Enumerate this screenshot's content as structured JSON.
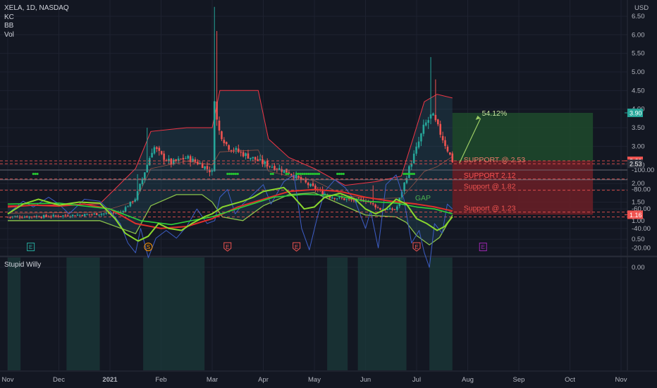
{
  "header": {
    "symbol_line": "XELA, 1D, NASDAQ",
    "indicators": [
      "KC",
      "BB",
      "Vol"
    ],
    "currency": "USD",
    "oscillator_name": "Stupid Willy"
  },
  "colors": {
    "background": "#131722",
    "grid": "#1e2230",
    "up": "#26a69a",
    "down": "#ef5350",
    "bb": "#f23645",
    "kc_lower": "#8bc34a",
    "osc_blue": "#3d5ec6",
    "osc_green": "#8ad82e",
    "osc_red": "#e0302b",
    "osc_bright_green": "#2ed13a",
    "target_box": "#1f4a2b",
    "stop_box": "#6b1f26",
    "support_line": "#ef5350",
    "gap_text": "#4caf50",
    "arrow": "#9ccc65"
  },
  "chart_data": [
    {
      "type": "candlestick",
      "title": "XELA, 1D, NASDAQ",
      "x_ticks": [
        "Nov",
        "Dec",
        "2021",
        "Feb",
        "Mar",
        "Apr",
        "May",
        "Jun",
        "Jul",
        "Aug",
        "Sep",
        "Oct",
        "Nov"
      ],
      "y_ticks": [
        0.5,
        1.0,
        1.5,
        2.0,
        2.5,
        3.0,
        3.5,
        4.0,
        4.5,
        5.0,
        5.5,
        6.0,
        6.5
      ],
      "ylim": [
        0.2,
        6.7
      ],
      "price_anchors": [
        [
          0,
          1.1
        ],
        [
          0.8,
          1.12
        ],
        [
          1.5,
          1.16
        ],
        [
          2.2,
          1.22
        ],
        [
          2.5,
          1.6
        ],
        [
          2.7,
          2.4
        ],
        [
          2.85,
          3.0
        ],
        [
          3.0,
          2.75
        ],
        [
          3.2,
          2.55
        ],
        [
          3.5,
          2.7
        ],
        [
          3.8,
          2.5
        ],
        [
          4.0,
          2.3
        ],
        [
          4.05,
          4.6
        ],
        [
          4.1,
          3.5
        ],
        [
          4.3,
          3.0
        ],
        [
          4.6,
          2.8
        ],
        [
          5.0,
          2.55
        ],
        [
          5.5,
          2.3
        ],
        [
          5.9,
          1.95
        ],
        [
          6.3,
          1.65
        ],
        [
          6.7,
          1.55
        ],
        [
          7.0,
          1.55
        ],
        [
          7.3,
          1.3
        ],
        [
          7.6,
          1.3
        ],
        [
          7.85,
          2.4
        ],
        [
          8.0,
          2.95
        ],
        [
          8.15,
          3.55
        ],
        [
          8.3,
          3.85
        ],
        [
          8.45,
          3.4
        ],
        [
          8.7,
          2.61
        ]
      ],
      "spikes": [
        {
          "month": 2.55,
          "high": 2.25
        },
        {
          "month": 2.72,
          "high": 3.5
        },
        {
          "month": 3.93,
          "high": 1.7
        },
        {
          "month": 4.05,
          "high": 6.75
        },
        {
          "month": 4.08,
          "high": 6.1
        },
        {
          "month": 5.1,
          "high": 2.4
        },
        {
          "month": 7.15,
          "high": 1.95
        },
        {
          "month": 8.28,
          "high": 5.4
        },
        {
          "month": 8.38,
          "high": 4.8
        }
      ],
      "bollinger": {
        "upper": [
          [
            0,
            1.4
          ],
          [
            1.8,
            1.45
          ],
          [
            2.5,
            2.4
          ],
          [
            2.8,
            3.4
          ],
          [
            3.5,
            3.5
          ],
          [
            4.0,
            3.5
          ],
          [
            4.15,
            4.5
          ],
          [
            4.9,
            4.5
          ],
          [
            5.1,
            3.2
          ],
          [
            5.5,
            2.7
          ],
          [
            6.0,
            2.4
          ],
          [
            6.6,
            1.95
          ],
          [
            7.2,
            2.05
          ],
          [
            7.7,
            2.2
          ],
          [
            7.95,
            3.3
          ],
          [
            8.15,
            4.2
          ],
          [
            8.4,
            4.4
          ],
          [
            8.7,
            4.3
          ]
        ],
        "lower": [
          [
            0,
            1.0
          ],
          [
            1.8,
            1.0
          ],
          [
            2.1,
            0.85
          ],
          [
            2.5,
            0.65
          ],
          [
            2.8,
            1.4
          ],
          [
            3.3,
            1.7
          ],
          [
            3.8,
            1.7
          ],
          [
            4.0,
            1.5
          ],
          [
            4.2,
            1.1
          ],
          [
            4.6,
            1.0
          ],
          [
            5.0,
            1.4
          ],
          [
            5.5,
            1.7
          ],
          [
            6.0,
            1.75
          ],
          [
            6.5,
            1.45
          ],
          [
            7.0,
            1.15
          ],
          [
            7.6,
            1.1
          ],
          [
            7.8,
            0.95
          ],
          [
            8.0,
            0.6
          ],
          [
            8.25,
            0.35
          ],
          [
            8.45,
            0.55
          ],
          [
            8.7,
            1.15
          ]
        ]
      },
      "keltner_lower": [
        [
          0,
          1.0
        ],
        [
          1.8,
          1.0
        ],
        [
          2.1,
          0.85
        ],
        [
          2.5,
          0.65
        ],
        [
          2.8,
          1.4
        ],
        [
          3.3,
          1.7
        ],
        [
          3.8,
          1.7
        ],
        [
          4.0,
          1.5
        ],
        [
          4.2,
          1.1
        ],
        [
          4.6,
          1.0
        ],
        [
          5.0,
          1.4
        ],
        [
          5.5,
          1.7
        ],
        [
          6.0,
          1.75
        ],
        [
          6.5,
          1.45
        ],
        [
          7.0,
          1.15
        ],
        [
          7.6,
          1.1
        ],
        [
          7.8,
          0.95
        ],
        [
          8.0,
          0.6
        ],
        [
          8.25,
          0.35
        ],
        [
          8.45,
          0.55
        ],
        [
          8.7,
          1.15
        ]
      ],
      "price_labels": [
        {
          "value": 3.9,
          "text": "3.90",
          "bg": "#26a69a"
        },
        {
          "value": 2.61,
          "text": "2.61",
          "bg": "#ef5350"
        },
        {
          "value": 2.53,
          "text": "2.53",
          "bg": "#2a2e39"
        },
        {
          "value": 1.16,
          "text": "1.16",
          "bg": "#ef5350"
        }
      ],
      "support_lines": [
        2.61,
        2.53,
        2.12,
        1.82,
        1.23,
        1.1
      ],
      "annotations": {
        "pct_gain": "54.12%",
        "supports": [
          {
            "text": "SUPPORT @ 2.53",
            "value": 2.53
          },
          {
            "text": "SUPPORT 2.12",
            "value": 2.12
          },
          {
            "text": "Support @ 1.82",
            "value": 1.82
          },
          {
            "text": "Support @ 1.23",
            "value": 1.23
          }
        ],
        "gap_label": "GAP",
        "target_box": {
          "from_month": 8.7,
          "to_month": 11.45,
          "top": 3.9,
          "bottom": 2.61
        },
        "stop_box": {
          "from_month": 8.7,
          "to_month": 11.45,
          "top": 2.61,
          "bottom": 1.16
        }
      },
      "event_markers": [
        {
          "month": 0.45,
          "letter": "E",
          "color": "#26a69a"
        },
        {
          "month": 2.75,
          "letter": "S",
          "color": "#ff9800"
        },
        {
          "month": 4.3,
          "letter": "E",
          "color": "#ef5350"
        },
        {
          "month": 5.65,
          "letter": "E",
          "color": "#ef5350"
        },
        {
          "month": 8.0,
          "letter": "E",
          "color": "#ef5350"
        },
        {
          "month": 9.3,
          "letter": "E",
          "color": "#9c27b0"
        }
      ]
    },
    {
      "type": "line",
      "title": "Stupid Willy",
      "y_ticks": [
        0,
        -20,
        -40,
        -60,
        -80,
        -100
      ],
      "y_tick_labels": [
        "0.00",
        "-20.00",
        "-40.00",
        "-60.00",
        "-80.00",
        "-100.00"
      ],
      "ylim": [
        -107,
        4
      ],
      "series": [
        {
          "key": "fast",
          "points": [
            [
              0,
              -55
            ],
            [
              0.3,
              -68
            ],
            [
              0.5,
              -62
            ],
            [
              0.8,
              -72
            ],
            [
              1.0,
              -65
            ],
            [
              1.2,
              -55
            ],
            [
              1.5,
              -70
            ],
            [
              1.8,
              -68
            ],
            [
              2.0,
              -58
            ],
            [
              2.2,
              -45
            ],
            [
              2.35,
              -25
            ],
            [
              2.5,
              -15
            ],
            [
              2.6,
              -40
            ],
            [
              2.75,
              -10
            ],
            [
              2.9,
              -30
            ],
            [
              3.1,
              -38
            ],
            [
              3.3,
              -30
            ],
            [
              3.5,
              -42
            ],
            [
              3.7,
              -60
            ],
            [
              3.9,
              -45
            ],
            [
              4.05,
              -48
            ],
            [
              4.15,
              -72
            ],
            [
              4.3,
              -80
            ],
            [
              4.45,
              -55
            ],
            [
              4.6,
              -65
            ],
            [
              4.8,
              -75
            ],
            [
              5.0,
              -85
            ],
            [
              5.15,
              -65
            ],
            [
              5.4,
              -88
            ],
            [
              5.6,
              -95
            ],
            [
              5.75,
              -40
            ],
            [
              5.9,
              -18
            ],
            [
              6.05,
              -50
            ],
            [
              6.2,
              -78
            ],
            [
              6.4,
              -90
            ],
            [
              6.6,
              -82
            ],
            [
              6.8,
              -68
            ],
            [
              7.0,
              -40
            ],
            [
              7.1,
              -58
            ],
            [
              7.25,
              -20
            ],
            [
              7.4,
              -85
            ],
            [
              7.6,
              -95
            ],
            [
              7.75,
              -70
            ],
            [
              7.9,
              -25
            ],
            [
              8.05,
              -38
            ],
            [
              8.15,
              -15
            ],
            [
              8.25,
              0
            ],
            [
              8.35,
              -45
            ],
            [
              8.5,
              -35
            ],
            [
              8.6,
              -65
            ],
            [
              8.7,
              -60
            ]
          ]
        },
        {
          "key": "green",
          "points": [
            [
              0,
              -55
            ],
            [
              0.3,
              -65
            ],
            [
              0.6,
              -70
            ],
            [
              1.0,
              -64
            ],
            [
              1.4,
              -67
            ],
            [
              1.8,
              -66
            ],
            [
              2.1,
              -50
            ],
            [
              2.3,
              -35
            ],
            [
              2.55,
              -27
            ],
            [
              2.75,
              -32
            ],
            [
              2.95,
              -45
            ],
            [
              3.15,
              -40
            ],
            [
              3.4,
              -38
            ],
            [
              3.6,
              -45
            ],
            [
              3.85,
              -52
            ],
            [
              4.0,
              -55
            ],
            [
              4.2,
              -62
            ],
            [
              4.4,
              -65
            ],
            [
              4.6,
              -68
            ],
            [
              4.8,
              -72
            ],
            [
              5.0,
              -78
            ],
            [
              5.2,
              -80
            ],
            [
              5.4,
              -82
            ],
            [
              5.6,
              -72
            ],
            [
              5.8,
              -60
            ],
            [
              6.0,
              -62
            ],
            [
              6.2,
              -72
            ],
            [
              6.5,
              -76
            ],
            [
              6.8,
              -70
            ],
            [
              7.0,
              -60
            ],
            [
              7.2,
              -55
            ],
            [
              7.4,
              -60
            ],
            [
              7.6,
              -70
            ],
            [
              7.8,
              -65
            ],
            [
              8.0,
              -50
            ],
            [
              8.2,
              -45
            ],
            [
              8.4,
              -38
            ],
            [
              8.55,
              -42
            ],
            [
              8.7,
              -52
            ]
          ]
        },
        {
          "key": "red",
          "points": [
            [
              0,
              -62
            ],
            [
              0.5,
              -64
            ],
            [
              1.0,
              -63
            ],
            [
              1.5,
              -65
            ],
            [
              2.0,
              -60
            ],
            [
              2.5,
              -45
            ],
            [
              3.0,
              -40
            ],
            [
              3.5,
              -42
            ],
            [
              4.0,
              -50
            ],
            [
              4.5,
              -62
            ],
            [
              5.0,
              -70
            ],
            [
              5.5,
              -78
            ],
            [
              6.0,
              -80
            ],
            [
              6.5,
              -78
            ],
            [
              7.0,
              -72
            ],
            [
              7.5,
              -68
            ],
            [
              8.0,
              -65
            ],
            [
              8.35,
              -62
            ],
            [
              8.7,
              -58
            ]
          ]
        },
        {
          "key": "slow",
          "points": [
            [
              0,
              -65
            ],
            [
              1.0,
              -66
            ],
            [
              2.0,
              -60
            ],
            [
              2.6,
              -48
            ],
            [
              3.2,
              -44
            ],
            [
              4.0,
              -52
            ],
            [
              4.6,
              -62
            ],
            [
              5.2,
              -72
            ],
            [
              5.8,
              -75
            ],
            [
              6.4,
              -74
            ],
            [
              7.0,
              -68
            ],
            [
              7.6,
              -66
            ],
            [
              8.0,
              -62
            ],
            [
              8.35,
              -60
            ],
            [
              8.7,
              -55
            ]
          ]
        }
      ],
      "shaded_ranges": [
        [
          0.0,
          0.25
        ],
        [
          1.15,
          1.8
        ],
        [
          2.65,
          3.85
        ],
        [
          6.25,
          6.65
        ],
        [
          6.85,
          7.8
        ],
        [
          8.25,
          8.7
        ]
      ],
      "hlines": [
        -90,
        -100
      ],
      "dot_ranges": [
        [
          0.5,
          0.6
        ],
        [
          4.3,
          4.5
        ],
        [
          5.15,
          5.2
        ],
        [
          5.45,
          5.5
        ],
        [
          5.65,
          6.1
        ],
        [
          6.45,
          6.6
        ],
        [
          7.75,
          7.95
        ]
      ]
    }
  ]
}
